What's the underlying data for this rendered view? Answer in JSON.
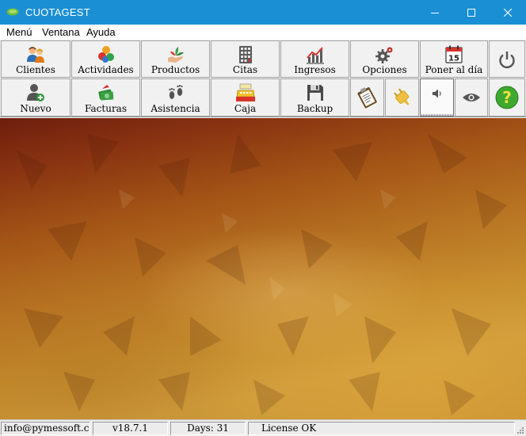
{
  "window": {
    "title": "CUOTAGEST",
    "minimize_icon": "minimize-icon",
    "maximize_icon": "maximize-icon",
    "close_icon": "close-icon"
  },
  "menu": {
    "items": [
      {
        "label": "Menú"
      },
      {
        "label": "Ventana"
      },
      {
        "label": "Ayuda"
      }
    ]
  },
  "toolbar": {
    "row1": [
      {
        "label": "Clientes",
        "icon": "clients-icon"
      },
      {
        "label": "Actividades",
        "icon": "activities-icon"
      },
      {
        "label": "Productos",
        "icon": "products-icon"
      },
      {
        "label": "Citas",
        "icon": "appointments-icon"
      },
      {
        "label": "Ingresos",
        "icon": "income-chart-icon"
      },
      {
        "label": "Opciones",
        "icon": "options-gears-icon"
      },
      {
        "label": "Poner al día",
        "icon": "calendar-15-icon",
        "calendar_day": "15"
      },
      {
        "label": "",
        "icon": "power-icon"
      }
    ],
    "row2": [
      {
        "label": "Nuevo",
        "icon": "new-client-icon"
      },
      {
        "label": "Facturas",
        "icon": "invoices-icon"
      },
      {
        "label": "Asistencia",
        "icon": "attendance-footprints-icon"
      },
      {
        "label": "Caja",
        "icon": "cash-register-icon"
      },
      {
        "label": "Backup",
        "icon": "floppy-disk-icon"
      },
      {
        "label": "",
        "icon": "clipboard-icon"
      },
      {
        "label": "",
        "icon": "plug-icon"
      },
      {
        "label": "",
        "icon": "speaker-icon"
      },
      {
        "label": "",
        "icon": "eye-icon"
      },
      {
        "label": "",
        "icon": "help-icon"
      }
    ]
  },
  "status": {
    "email": "info@pymessoft.com",
    "version": "v18.7.1",
    "days": "Days: 31",
    "license": "License OK"
  },
  "colors": {
    "titlebar": "#1a8fd4",
    "toolbar_bg": "#ececec"
  }
}
